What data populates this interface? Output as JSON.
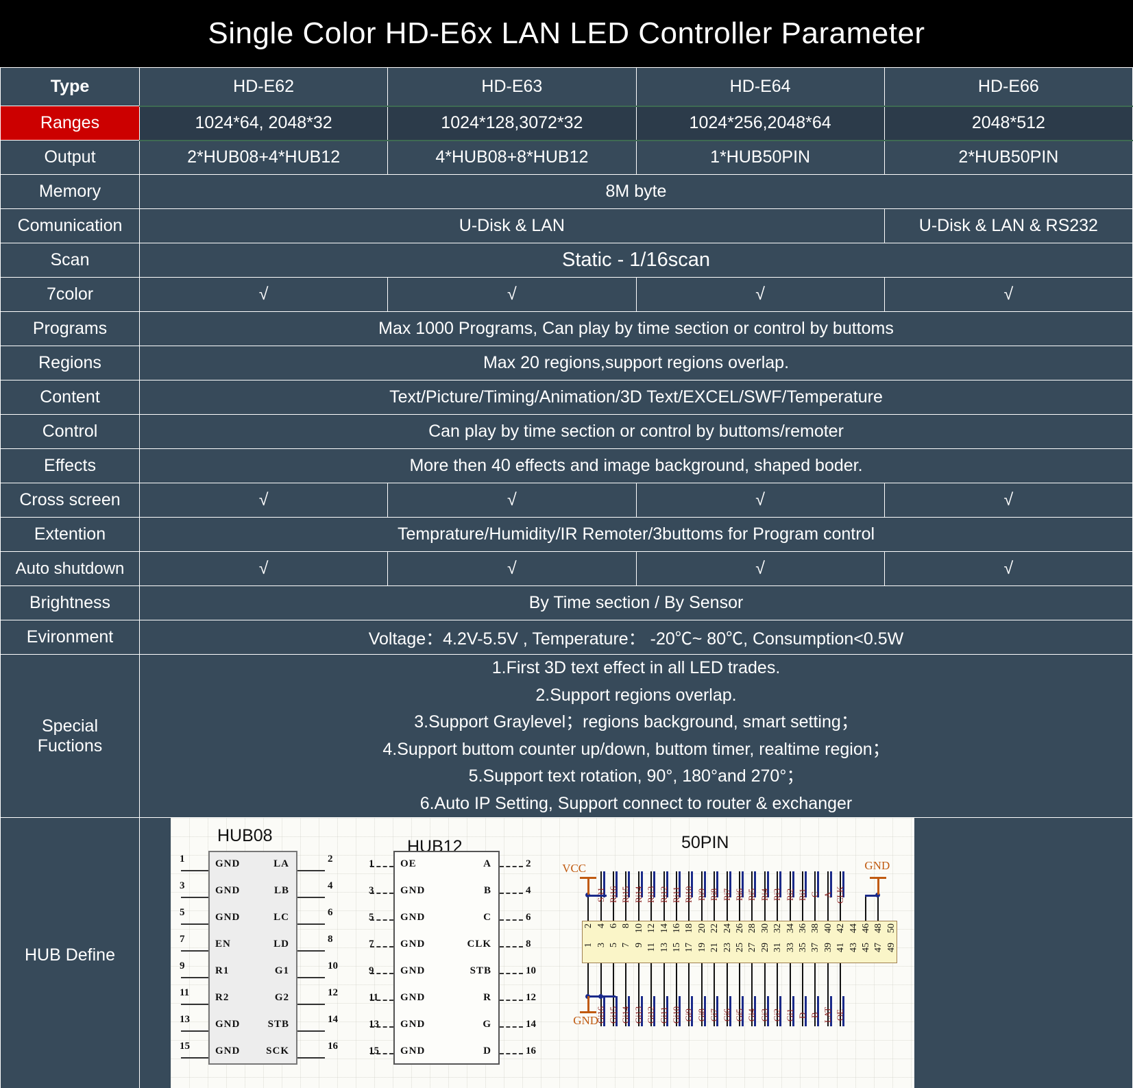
{
  "title": "Single Color HD-E6x LAN LED Controller Parameter",
  "colors": {
    "accent_red": "#CC0000",
    "panel_bg": "#374A5A",
    "ranges_row_bg": "#2C3B4A",
    "title_bg": "#000000",
    "text": "#FFFFFF",
    "dim_text": "#B9BEC4"
  },
  "table": {
    "header": {
      "label": "Type",
      "models": [
        "HD-E62",
        "HD-E63",
        "HD-E64",
        "HD-E66"
      ]
    },
    "rows": [
      {
        "label": "Ranges",
        "type": "cells",
        "dim": true,
        "cells": [
          "1024*64,  2048*32",
          "1024*128,3072*32",
          "1024*256,2048*64",
          "2048*512"
        ]
      },
      {
        "label": "Output",
        "type": "cells",
        "cells": [
          "2*HUB08+4*HUB12",
          "4*HUB08+8*HUB12",
          "1*HUB50PIN",
          "2*HUB50PIN"
        ]
      },
      {
        "label": "Memory",
        "type": "span4",
        "value": "8M byte"
      },
      {
        "label": "Comunication",
        "type": "split3_1",
        "value_left": "U-Disk & LAN",
        "value_right": "U-Disk & LAN & RS232"
      },
      {
        "label": "Scan",
        "type": "span4",
        "value": "Static - 1/16scan"
      },
      {
        "label": "7color",
        "type": "cells",
        "cells": [
          "√",
          "√",
          "√",
          "√"
        ]
      },
      {
        "label": "Programs",
        "type": "span4",
        "value": "Max 1000 Programs,   Can play by time section or control by buttoms"
      },
      {
        "label": "Regions",
        "type": "span4",
        "value": "Max 20 regions,support regions overlap."
      },
      {
        "label": "Content",
        "type": "span4",
        "value": "Text/Picture/Timing/Animation/3D Text/EXCEL/SWF/Temperature"
      },
      {
        "label": "Control",
        "type": "span4",
        "value": "Can play by time section or control by buttoms/remoter"
      },
      {
        "label": "Effects",
        "type": "span4",
        "value": "More then 40 effects and image background, shaped boder."
      },
      {
        "label": "Cross screen",
        "type": "cells",
        "cells": [
          "√",
          "√",
          "√",
          "√"
        ]
      },
      {
        "label": "Extention",
        "type": "span4",
        "value": "Temprature/Humidity/IR Remoter/3buttoms for Program control"
      },
      {
        "label": "Auto shutdown",
        "type": "cells",
        "cells": [
          "√",
          "√",
          "√",
          "√"
        ]
      },
      {
        "label": "Brightness",
        "type": "span4",
        "value": "By Time section / By Sensor"
      },
      {
        "label": "Evironment",
        "type": "span4",
        "value": "Voltage：4.2V-5.5V ,   Temperature： -20℃~ 80℃,   Consumption<0.5W"
      }
    ],
    "special": {
      "label_line1": "Special",
      "label_line2": "Fuctions",
      "lines": [
        "1.First 3D text effect in all LED trades.",
        "2.Support regions overlap.",
        "3.Support Graylevel；regions background,  smart setting；",
        "4.Support buttom counter up/down,  buttom timer,  realtime region；",
        "5.Support text rotation,  90°, 180°and 270°；",
        "6.Auto IP Setting, Support connect to router & exchanger"
      ]
    },
    "hub_define": {
      "label": "HUB Define",
      "hub08": {
        "title": "HUB08",
        "left_pins": [
          {
            "n": "1",
            "name": "GND"
          },
          {
            "n": "3",
            "name": "GND"
          },
          {
            "n": "5",
            "name": "GND"
          },
          {
            "n": "7",
            "name": "EN"
          },
          {
            "n": "9",
            "name": "R1"
          },
          {
            "n": "11",
            "name": "R2"
          },
          {
            "n": "13",
            "name": "GND"
          },
          {
            "n": "15",
            "name": "GND"
          }
        ],
        "right_pins": [
          {
            "n": "2",
            "name": "LA"
          },
          {
            "n": "4",
            "name": "LB"
          },
          {
            "n": "6",
            "name": "LC"
          },
          {
            "n": "8",
            "name": "LD"
          },
          {
            "n": "10",
            "name": "G1"
          },
          {
            "n": "12",
            "name": "G2"
          },
          {
            "n": "14",
            "name": "STB"
          },
          {
            "n": "16",
            "name": "SCK"
          }
        ]
      },
      "hub12": {
        "title": "HUB12",
        "left_pins": [
          {
            "n": "1",
            "name": "OE"
          },
          {
            "n": "3",
            "name": "GND"
          },
          {
            "n": "5",
            "name": "GND"
          },
          {
            "n": "7",
            "name": "GND"
          },
          {
            "n": "9",
            "name": "GND"
          },
          {
            "n": "11",
            "name": "GND"
          },
          {
            "n": "13",
            "name": "GND"
          },
          {
            "n": "15",
            "name": "GND"
          }
        ],
        "right_pins": [
          {
            "n": "2",
            "name": "A"
          },
          {
            "n": "4",
            "name": "B"
          },
          {
            "n": "6",
            "name": "C"
          },
          {
            "n": "8",
            "name": "CLK"
          },
          {
            "n": "10",
            "name": "STB"
          },
          {
            "n": "12",
            "name": "R"
          },
          {
            "n": "14",
            "name": "G"
          },
          {
            "n": "16",
            "name": "D"
          }
        ]
      },
      "pin50": {
        "title": "50PIN",
        "vcc_label": "VCC",
        "gnd_label_left": "GND",
        "gnd_label_right": "GND",
        "top_labels": [
          "SR1",
          "Ri16",
          "Ri15",
          "Ri14",
          "Ri13",
          "Ri12",
          "Ri11",
          "Ri10",
          "Ri9",
          "Ri8",
          "Ri7",
          "Ri6",
          "Ri5",
          "Ri4",
          "Ri3",
          "Ri2",
          "Ri1",
          "C",
          "A",
          "CLK"
        ],
        "bottom_labels": [
          "Gi16",
          "Gi15",
          "Gi14",
          "Gi13",
          "Gi12",
          "Gi11",
          "Gi10",
          "Gi9",
          "Gi8",
          "Gi7",
          "Gi6",
          "Gi5",
          "Gi4",
          "Gi3",
          "Gi2",
          "Gi1",
          "D",
          "B",
          "LAT",
          "OE"
        ],
        "top_numbers": [
          "2",
          "4",
          "6",
          "8",
          "10",
          "12",
          "14",
          "16",
          "18",
          "20",
          "22",
          "24",
          "26",
          "28",
          "30",
          "32",
          "34",
          "36",
          "38",
          "40",
          "42",
          "44",
          "46",
          "48",
          "50"
        ],
        "bottom_numbers": [
          "1",
          "3",
          "5",
          "7",
          "9",
          "11",
          "13",
          "15",
          "17",
          "19",
          "21",
          "23",
          "25",
          "27",
          "29",
          "31",
          "33",
          "35",
          "37",
          "39",
          "41",
          "43",
          "45",
          "47",
          "49"
        ]
      }
    }
  }
}
